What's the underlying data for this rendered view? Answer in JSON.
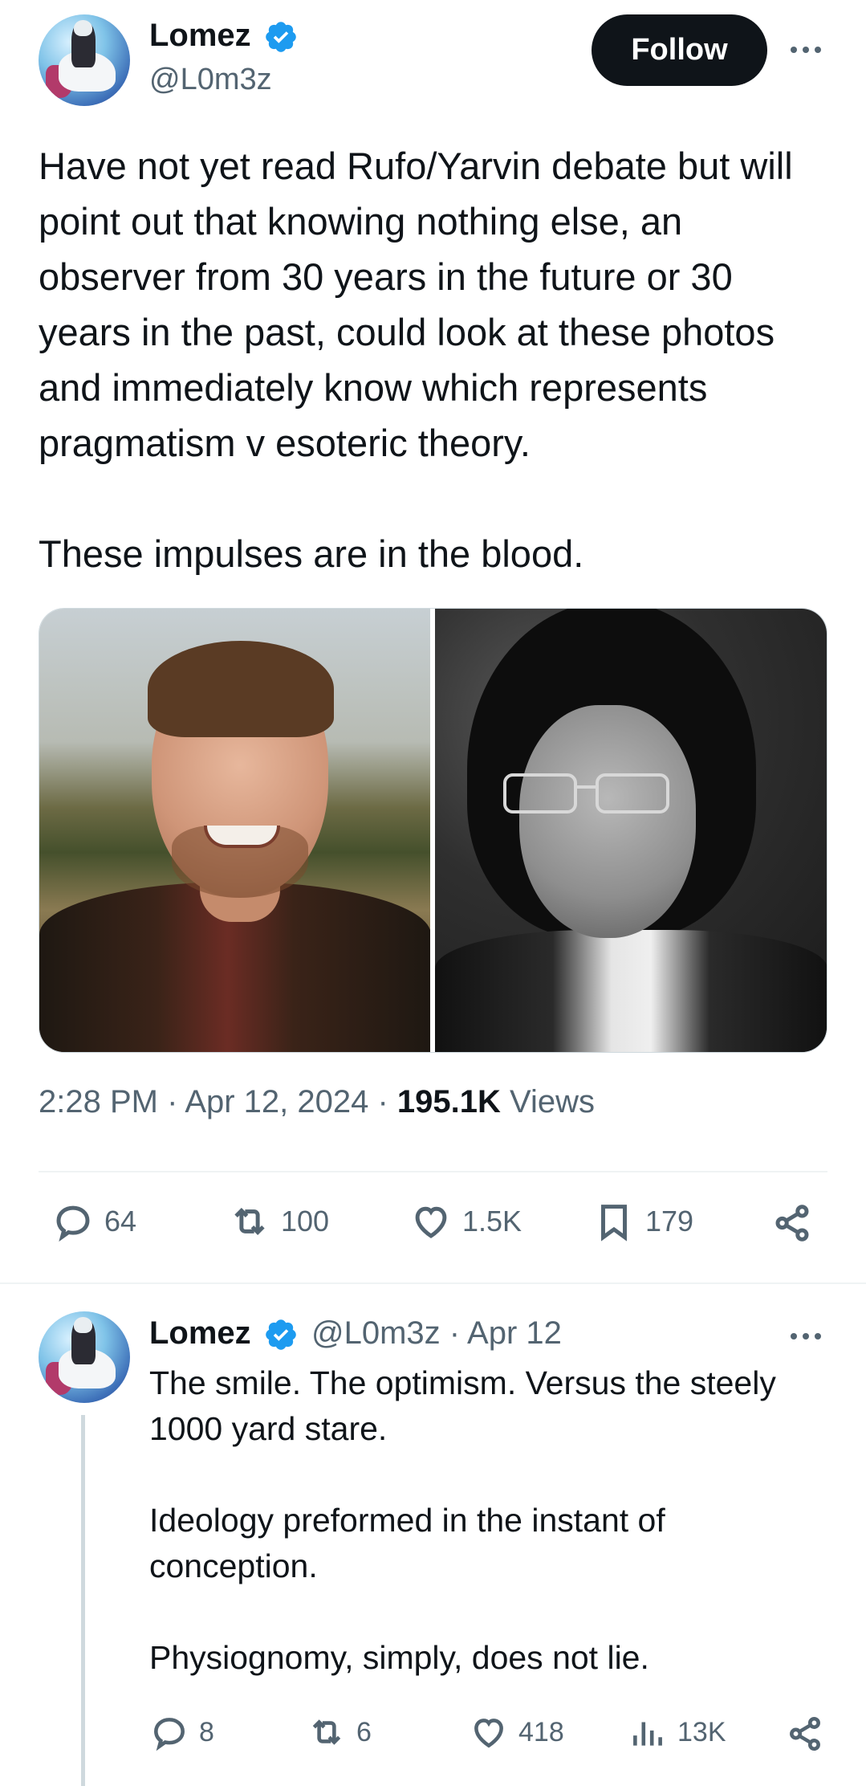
{
  "main_tweet": {
    "author_name": "Lomez",
    "handle": "@L0m3z",
    "follow_label": "Follow",
    "text": "Have not yet read Rufo/Yarvin debate but will point out that knowing nothing else, an observer from 30 years in the future or 30 years in the past, could look at these photos and immediately know which represents pragmatism v esoteric theory.\n\nThese impulses are in the blood.",
    "time": "2:28 PM",
    "date": "Apr 12, 2024",
    "views_count": "195.1K",
    "views_label": "Views",
    "replies": "64",
    "reposts": "100",
    "likes": "1.5K",
    "bookmarks": "179"
  },
  "reply_tweet": {
    "author_name": "Lomez",
    "handle": "@L0m3z",
    "date": "Apr 12",
    "text": "The smile. The optimism. Versus the steely 1000 yard stare.\n\nIdeology preformed in the instant of conception.\n\nPhysiognomy, simply, does not lie.",
    "replies": "8",
    "reposts": "6",
    "likes": "418",
    "views": "13K"
  },
  "colors": {
    "text_primary": "#0f1419",
    "text_secondary": "#536471",
    "verified_blue": "#1d9bf0",
    "divider": "#eff3f4"
  },
  "icons": [
    "verified-badge-icon",
    "more-icon",
    "reply-icon",
    "repost-icon",
    "like-icon",
    "bookmark-icon",
    "share-icon",
    "views-icon"
  ]
}
